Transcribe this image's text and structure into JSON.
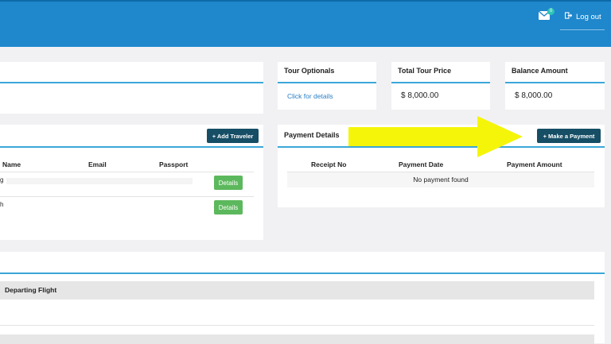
{
  "header": {
    "notification_count": "0",
    "logout_label": "Log out"
  },
  "summary": {
    "tour_optionals": {
      "title": "Tour Optionals",
      "link": "Click for details"
    },
    "total_price": {
      "title": "Total Tour Price",
      "value": "$ 8,000.00"
    },
    "balance": {
      "title": "Balance Amount",
      "value": "$ 8,000.00"
    }
  },
  "travelers": {
    "add_button": "+ Add Traveler",
    "columns": [
      "Name",
      "Email",
      "Passport"
    ],
    "rows": [
      {
        "name": "g",
        "details_label": "Details"
      },
      {
        "name": "h",
        "details_label": "Details"
      }
    ]
  },
  "payments": {
    "title": "Payment Details",
    "make_payment_button": "+ Make a Payment",
    "columns": [
      "Receipt No",
      "Payment Date",
      "Payment Amount"
    ],
    "empty_message": "No payment found"
  },
  "flights": {
    "departing_label": "Departing Flight"
  },
  "colors": {
    "header": "#1f87cc",
    "accent_rule": "#3aa7d8",
    "dark_button": "#164e66",
    "green_button": "#5cb85c",
    "annotation_arrow": "#f5f50a"
  }
}
